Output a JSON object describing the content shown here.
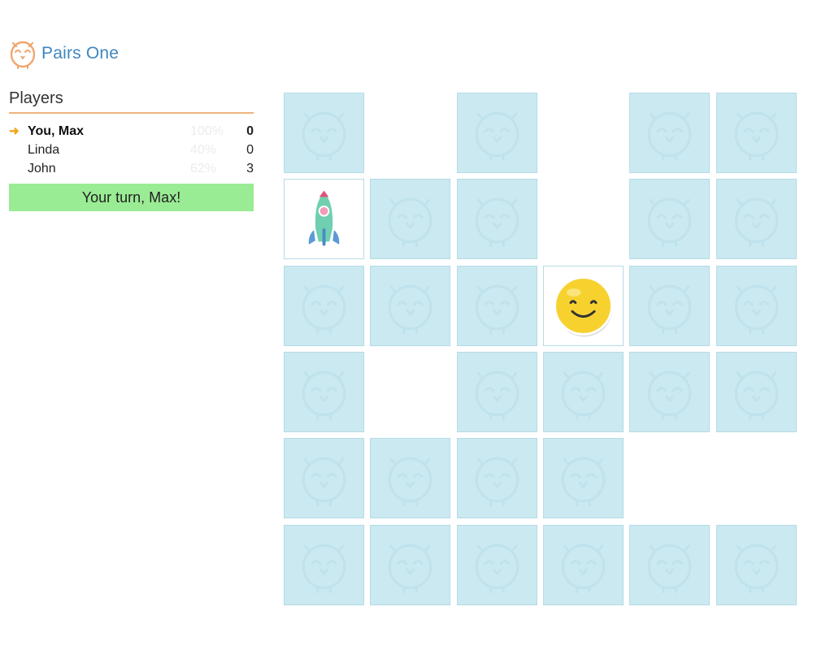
{
  "app": {
    "title": "Pairs One"
  },
  "players": {
    "heading": "Players",
    "list": [
      {
        "name": "You, Max",
        "percent": "100%",
        "score": "0",
        "current": true
      },
      {
        "name": "Linda",
        "percent": "40%",
        "score": "0",
        "current": false
      },
      {
        "name": "John",
        "percent": "62%",
        "score": "3",
        "current": false
      }
    ],
    "turn_message": "Your turn, Max!"
  },
  "colors": {
    "accent": "#3f86c0",
    "card_back": "#cae9f1",
    "turn_banner": "#9aec94",
    "turn_arrow": "#f0a61a",
    "heading_rule": "#f0b47e"
  },
  "board": {
    "rows": 6,
    "cols": 6,
    "cells": [
      [
        "back",
        "empty",
        "back",
        "empty",
        "back",
        "back"
      ],
      [
        "face:rocket",
        "back",
        "back",
        "empty",
        "back",
        "back"
      ],
      [
        "back",
        "back",
        "back",
        "face:smiley",
        "back",
        "back"
      ],
      [
        "back",
        "empty",
        "back",
        "back",
        "back",
        "back"
      ],
      [
        "back",
        "back",
        "back",
        "back",
        "empty",
        "empty"
      ],
      [
        "back",
        "back",
        "back",
        "back",
        "back",
        "back"
      ]
    ]
  }
}
